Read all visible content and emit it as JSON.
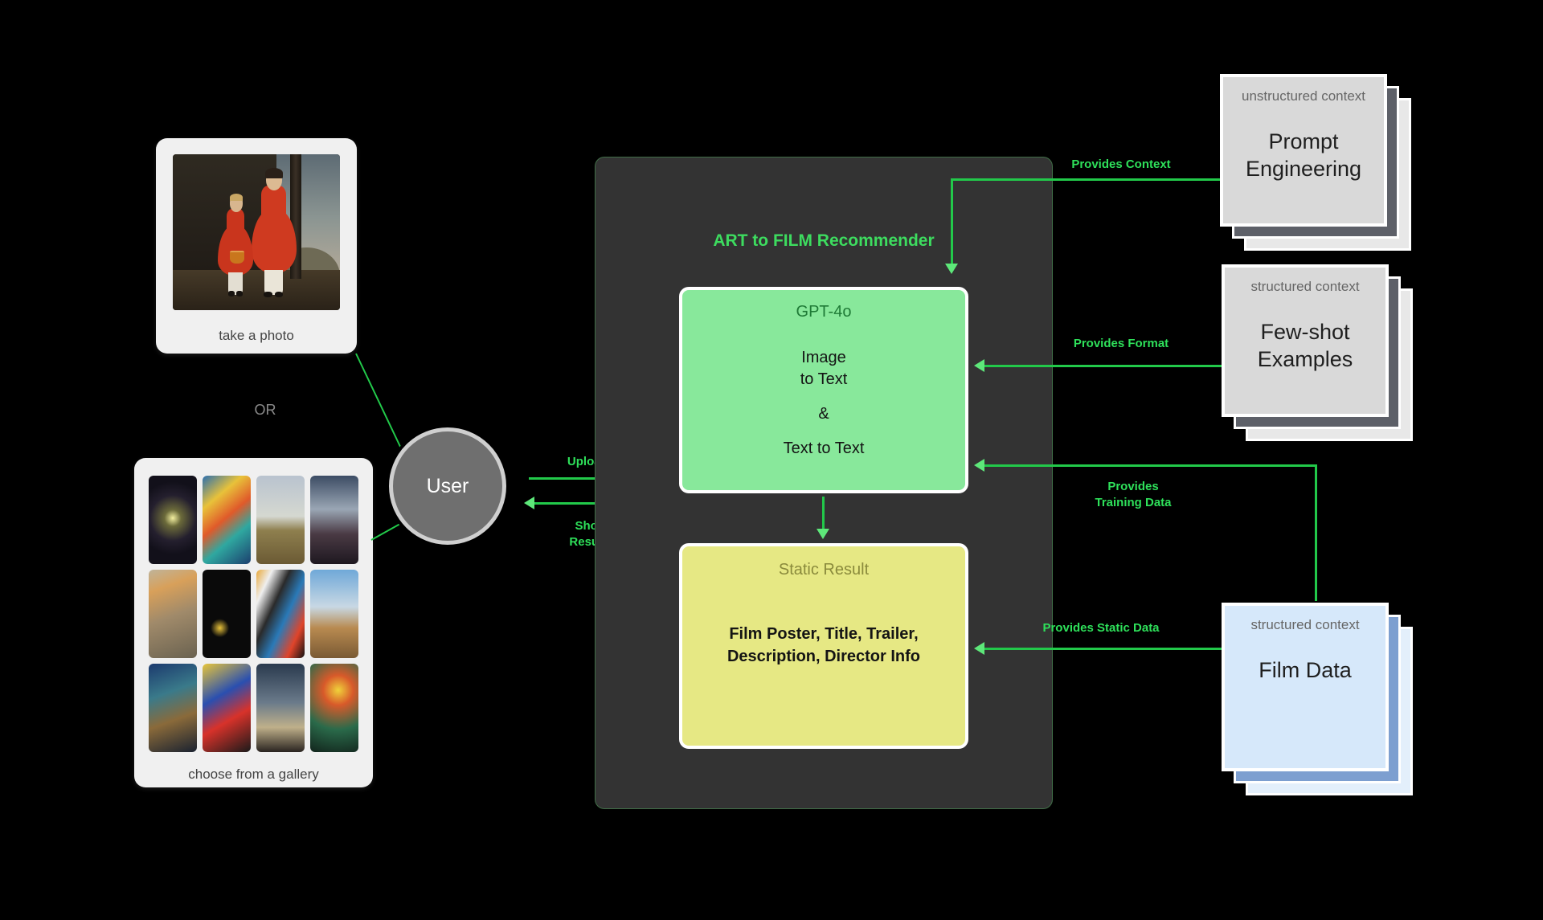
{
  "diagram": {
    "title": "ART to FILM Recommender",
    "background_color": "#000000",
    "accent_color": "#2ee05a"
  },
  "inputs": {
    "photo_card": {
      "caption": "take a photo",
      "image_alt": "folk-art painting of two children in red dresses"
    },
    "or_label": "OR",
    "gallery_card": {
      "caption": "choose from a gallery",
      "tiles": [
        "ufo-over-field",
        "abstract-faces-yellow-blue",
        "dalmatian-dog-clouds",
        "skull-planet-surreal",
        "lion-with-orb-ruins",
        "black-cosmic-dots",
        "rainbow-swirl-abstract",
        "surreal-desert-ufo",
        "blue-figure-fantasy",
        "pop-art-yellow-ant",
        "eiffel-tower-silhouette",
        "green-dragon-sun"
      ]
    }
  },
  "user": {
    "label": "User"
  },
  "system": {
    "title": "ART to FILM Recommender",
    "gpt_box": {
      "title": "GPT-4o",
      "line1": "Image",
      "line2": "to Text",
      "connector": "&",
      "line3": "Text to Text",
      "color": "#88e89b"
    },
    "static_box": {
      "title": "Static Result",
      "line1": "Film Poster, Title, Trailer,",
      "line2": "Description, Director Info",
      "color": "#e6e884"
    }
  },
  "context_cards": [
    {
      "subtitle": "unstructured context",
      "title": "Prompt\nEngineering",
      "color": "#d9d9d9"
    },
    {
      "subtitle": "structured context",
      "title": "Few-shot\nExamples",
      "color": "#d9d9d9"
    },
    {
      "subtitle": "structured context",
      "title": "Film Data",
      "color": "#d6e8fa"
    }
  ],
  "edges": {
    "uploads": "Uploads",
    "show_results": "Show\nResults",
    "provides_context": "Provides Context",
    "provides_format": "Provides Format",
    "provides_training_data": "Provides\nTraining Data",
    "provides_static_data": "Provides Static Data"
  }
}
